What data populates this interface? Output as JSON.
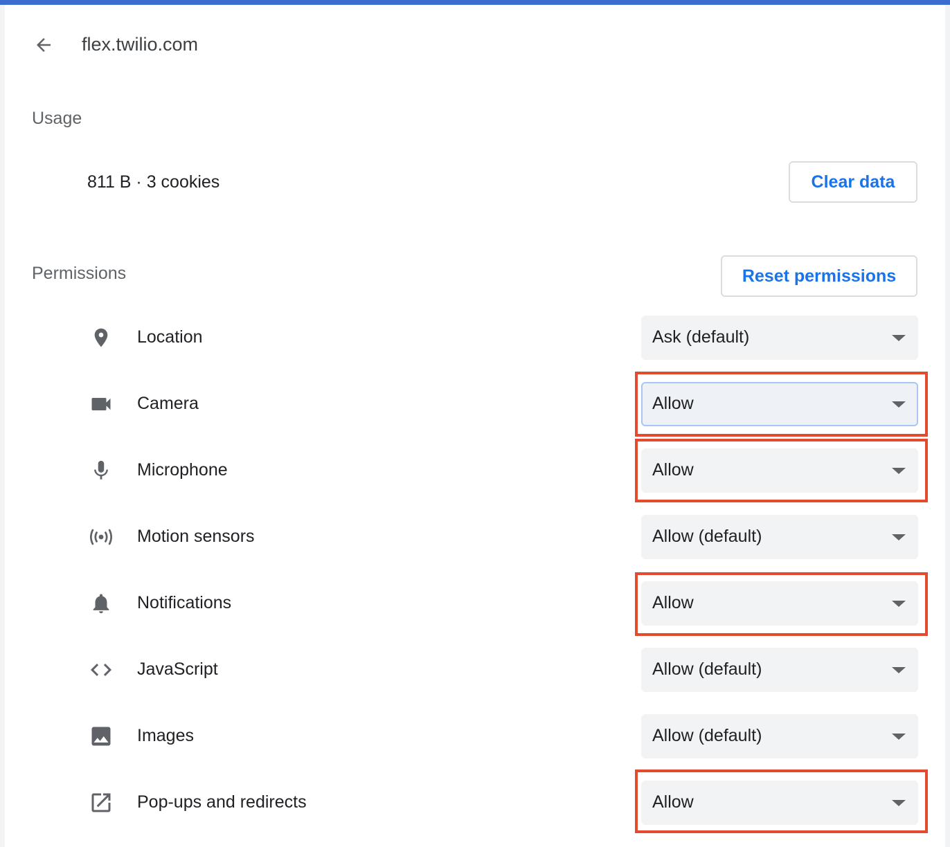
{
  "header": {
    "back_icon": "arrow-back-icon",
    "site": "flex.twilio.com"
  },
  "usage": {
    "label": "Usage",
    "summary": "811 B · 3 cookies",
    "clear_button": "Clear data"
  },
  "permissions": {
    "label": "Permissions",
    "reset_button": "Reset permissions",
    "items": [
      {
        "label": "Location",
        "icon": "location-pin-icon",
        "value": "Ask (default)"
      },
      {
        "label": "Camera",
        "icon": "camera-icon",
        "value": "Allow"
      },
      {
        "label": "Microphone",
        "icon": "microphone-icon",
        "value": "Allow"
      },
      {
        "label": "Motion sensors",
        "icon": "motion-sensors-icon",
        "value": "Allow (default)"
      },
      {
        "label": "Notifications",
        "icon": "bell-icon",
        "value": "Allow"
      },
      {
        "label": "JavaScript",
        "icon": "code-icon",
        "value": "Allow (default)"
      },
      {
        "label": "Images",
        "icon": "image-icon",
        "value": "Allow (default)"
      },
      {
        "label": "Pop-ups and redirects",
        "icon": "open-in-new-icon",
        "value": "Allow"
      }
    ]
  },
  "colors": {
    "accent": "#1a73e8",
    "top_bar": "#3b6cd0",
    "annotation": "#e34a2f"
  }
}
